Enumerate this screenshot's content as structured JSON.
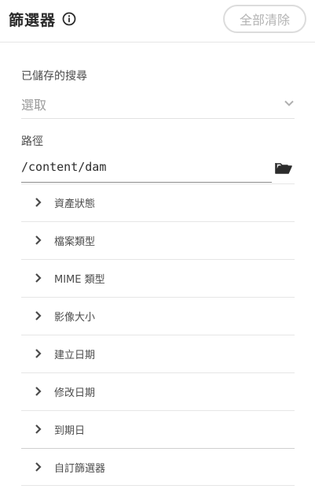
{
  "header": {
    "title": "篩選器",
    "info_icon": "info-circle-icon",
    "clear_all_label": "全部清除"
  },
  "saved_search": {
    "label": "已儲存的搜尋",
    "value": "選取",
    "icon": "chevron-down-icon"
  },
  "path": {
    "label": "路徑",
    "value": "/content/dam",
    "icon": "folder-open-icon"
  },
  "sections": [
    {
      "label": "資產狀態"
    },
    {
      "label": "檔案類型"
    },
    {
      "label": "MIME 類型"
    },
    {
      "label": "影像大小"
    },
    {
      "label": "建立日期"
    },
    {
      "label": "修改日期"
    },
    {
      "label": "到期日"
    },
    {
      "label": "自訂篩選器"
    }
  ],
  "colors": {
    "text": "#2c2c2c",
    "muted": "#9a9a9a",
    "divider": "#e6e6e6",
    "button_border": "#dcdcdc"
  }
}
